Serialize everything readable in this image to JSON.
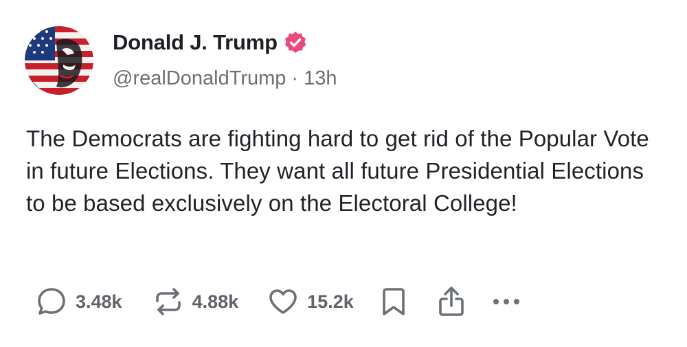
{
  "author": {
    "display_name": "Donald J. Trump",
    "handle": "@realDonaldTrump",
    "separator": "·",
    "time_ago": "13h",
    "verified": true,
    "verified_color": "#e94b7c"
  },
  "post": {
    "text": "The Democrats are fighting hard to get rid of the Popular Vote in future Elections. They want all future Presidential Elections to be based exclusively on the Electoral College!"
  },
  "actions": {
    "reply": {
      "icon": "reply-icon",
      "count": "3.48k"
    },
    "repost": {
      "icon": "repost-icon",
      "count": "4.88k"
    },
    "like": {
      "icon": "heart-icon",
      "count": "15.2k"
    },
    "bookmark": {
      "icon": "bookmark-icon"
    },
    "share": {
      "icon": "share-icon"
    },
    "more": {
      "icon": "more-icon"
    }
  },
  "colors": {
    "text": "#1f2328",
    "muted": "#6b6f76",
    "background": "#ffffff"
  }
}
